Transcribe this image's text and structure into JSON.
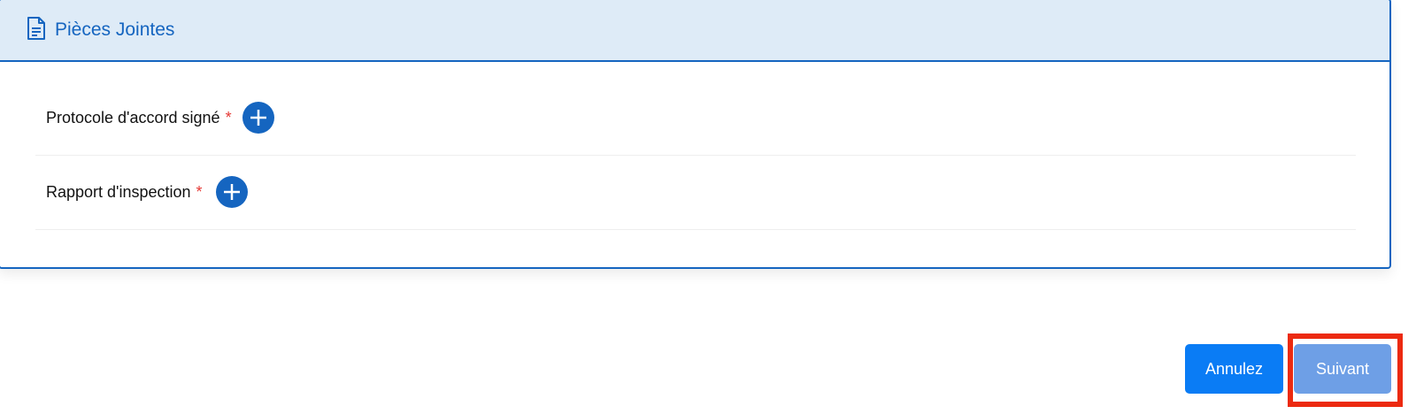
{
  "attachments": {
    "title": "Pièces Jointes",
    "icon": "document-icon",
    "items": [
      {
        "label": "Protocole d'accord signé",
        "required_marker": "*"
      },
      {
        "label": "Rapport d'inspection",
        "required_marker": "*"
      }
    ]
  },
  "actions": {
    "cancel_label": "Annulez",
    "next_label": "Suivant"
  },
  "colors": {
    "accent": "#1565c0",
    "header_bg": "#deebf7",
    "required": "#e53935",
    "cancel_button": "#0a7cf5",
    "next_button": "#6e9fe6",
    "highlight": "#ec2a10"
  }
}
